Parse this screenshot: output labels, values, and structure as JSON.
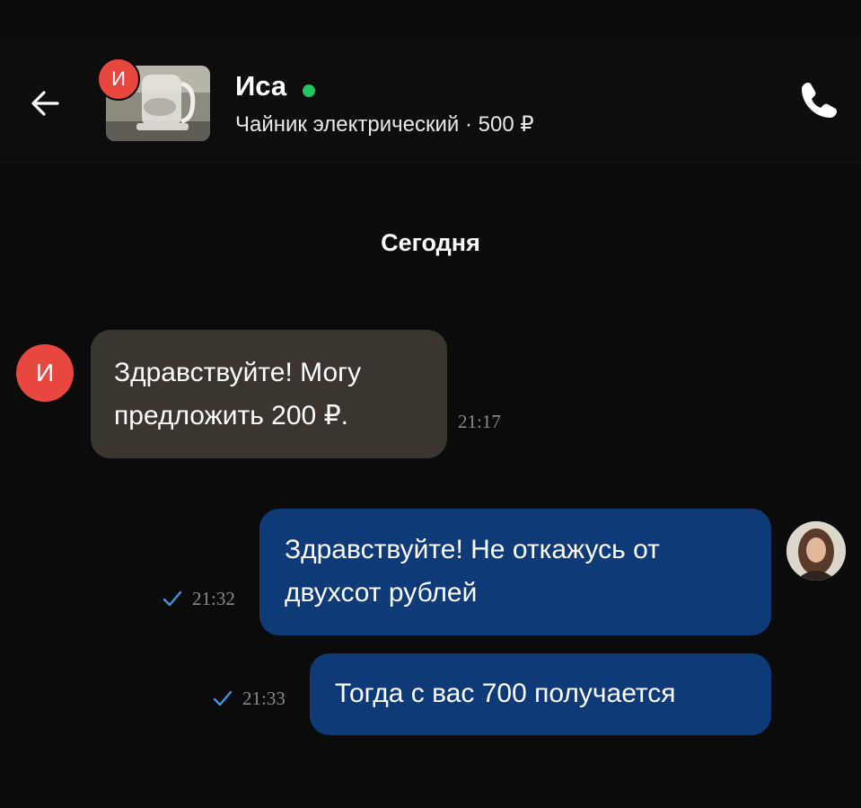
{
  "header": {
    "contact_name": "Иса",
    "avatar_letter": "И",
    "online": true,
    "item_title": "Чайник электрический",
    "item_price": "500 ₽",
    "item_line": "Чайник электрический · 500 ₽"
  },
  "date_separator": "Сегодня",
  "messages": [
    {
      "direction": "incoming",
      "avatar_letter": "И",
      "text": "Здравствуйте! Могу предложить 200 ₽.",
      "time": "21:17"
    },
    {
      "direction": "outgoing",
      "text": "Здравствуйте! Не откажусь от двухсот рублей",
      "time": "21:32",
      "read": true
    },
    {
      "direction": "outgoing",
      "text": "Тогда с вас 700 получается",
      "time": "21:33",
      "read": true
    }
  ],
  "colors": {
    "background": "#0b0b0b",
    "incoming_bubble": "#3a362f",
    "outgoing_bubble": "#0f3a78",
    "avatar_red": "#e8473f",
    "online_green": "#22c55e",
    "check_blue": "#4a90e2"
  },
  "icons": {
    "back": "arrow-left-icon",
    "call": "phone-icon",
    "read": "checkmark-icon"
  }
}
